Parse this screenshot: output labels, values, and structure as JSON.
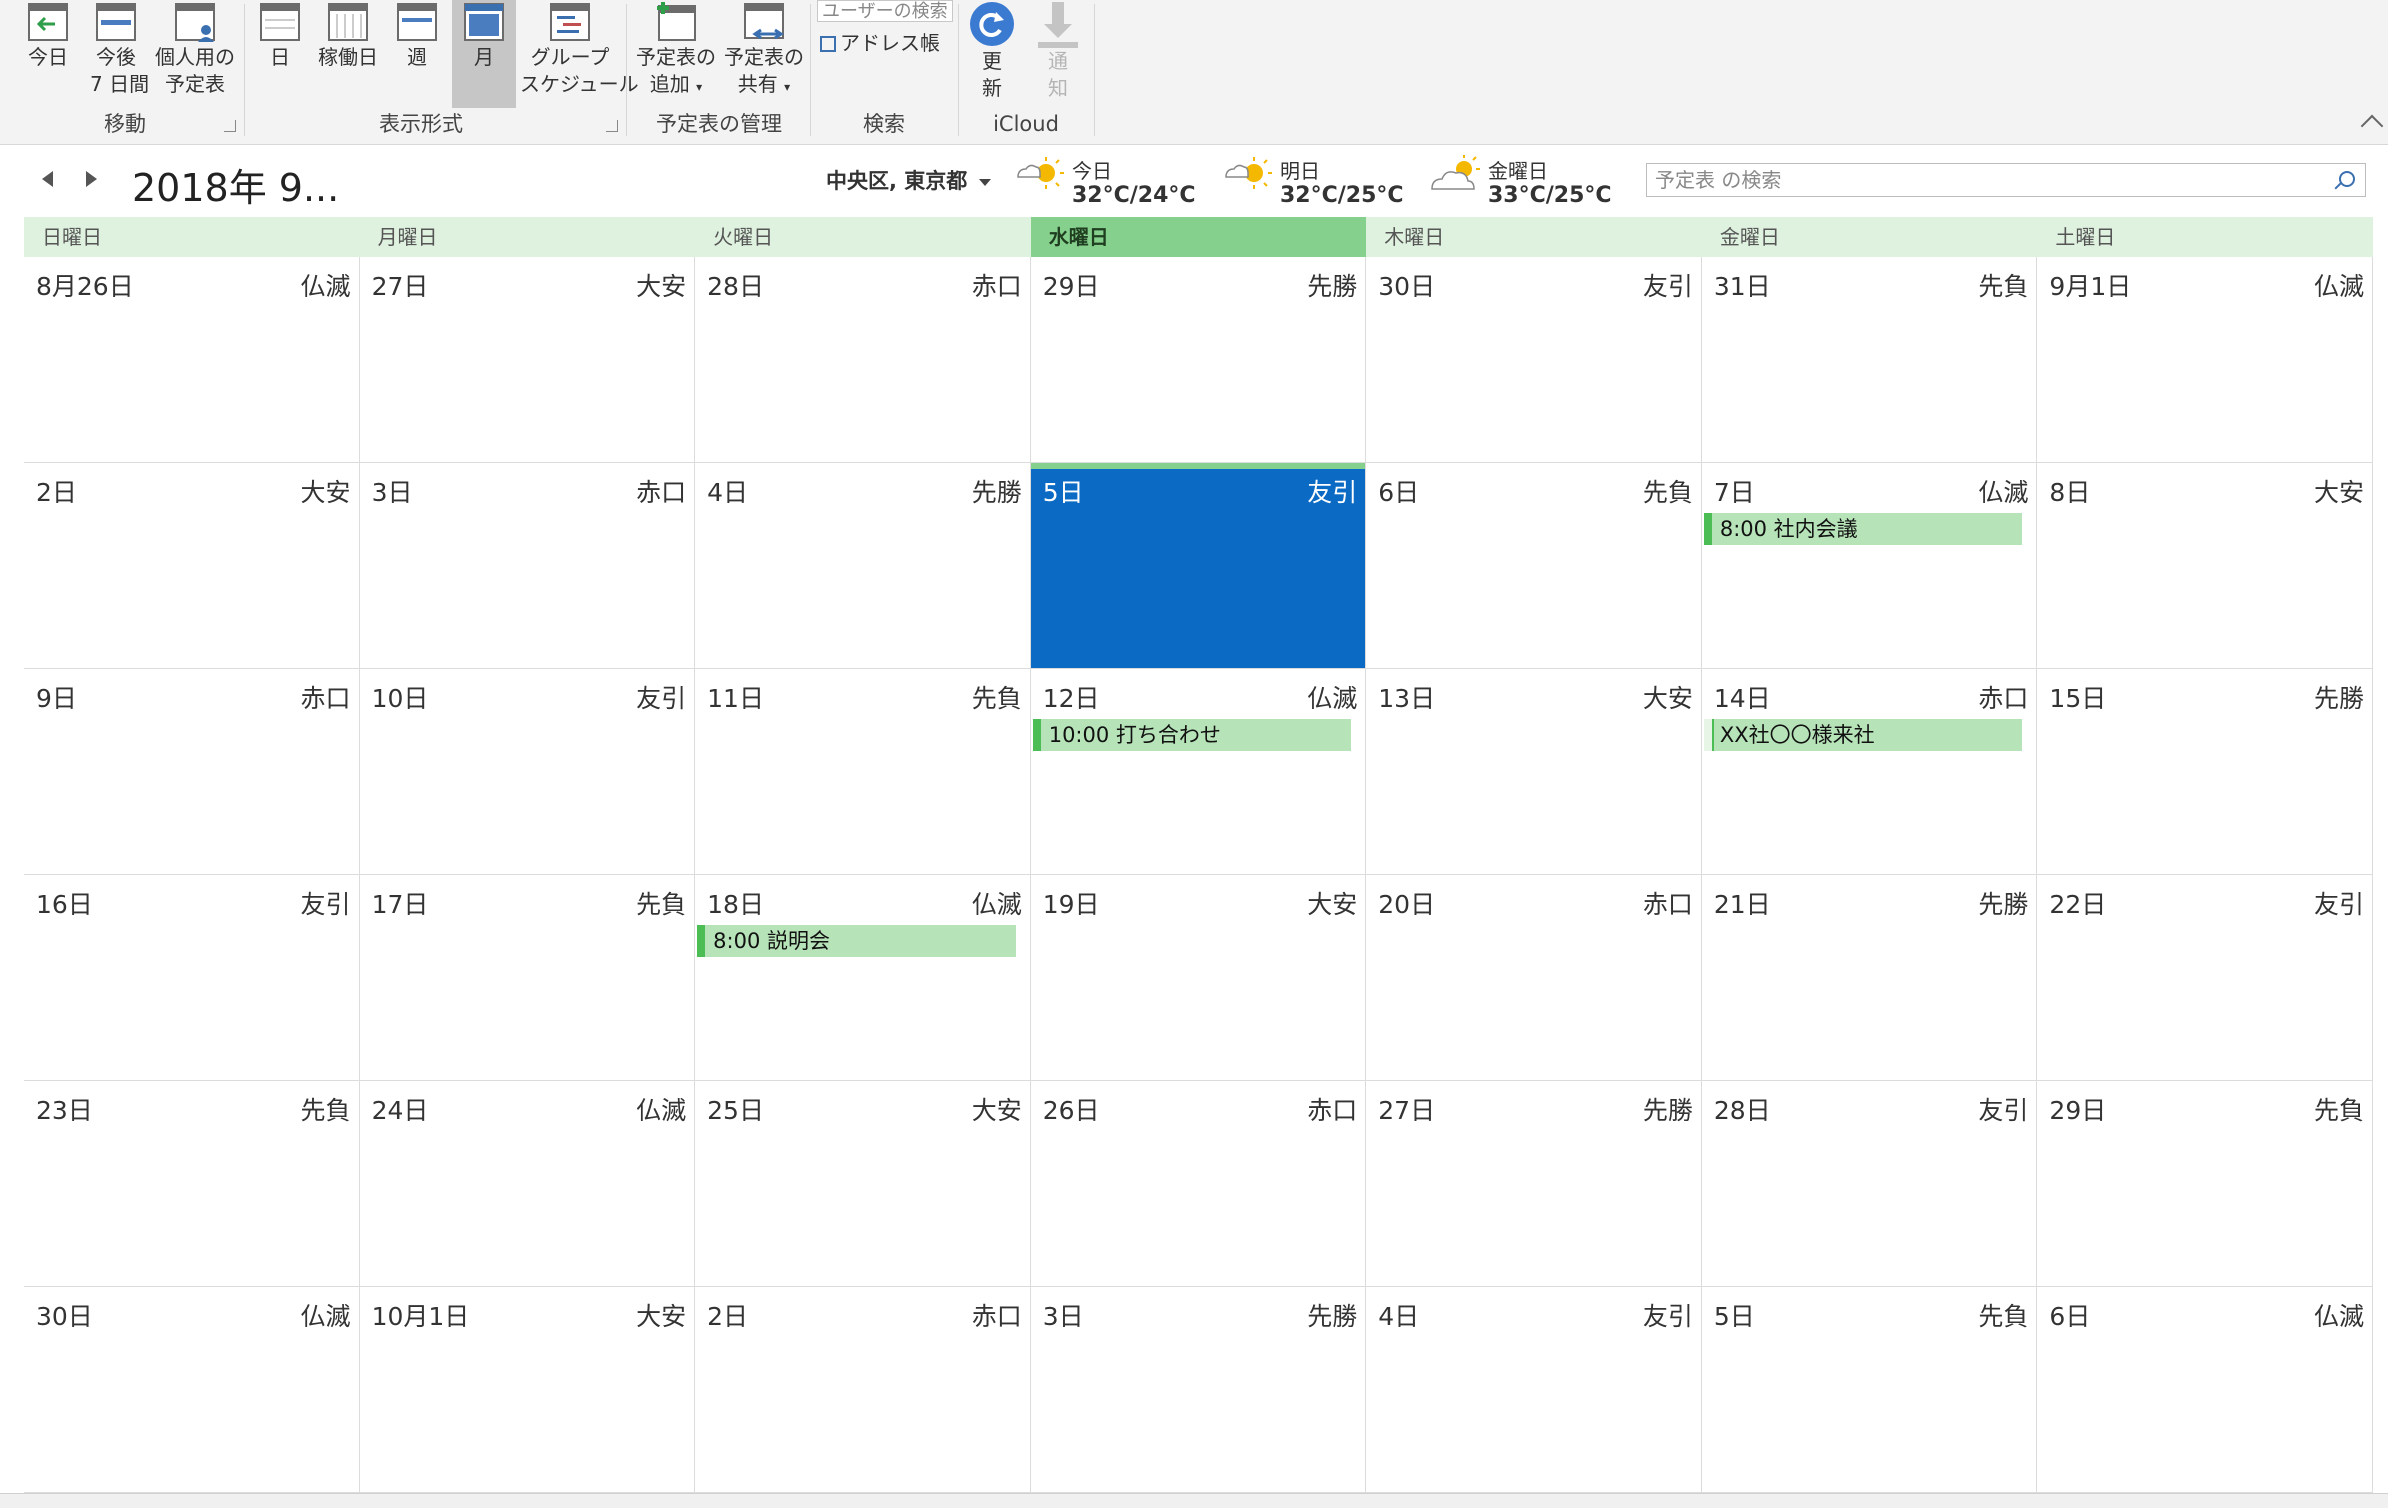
{
  "ribbon": {
    "groups": {
      "move": "移動",
      "view": "表示形式",
      "manage": "予定表の管理",
      "search": "検索",
      "icloud": "iCloud"
    },
    "buttons": {
      "today": "今日",
      "next7_line1": "今後",
      "next7_line2": "7 日間",
      "personal_line1": "個人用の",
      "personal_line2": "予定表",
      "day": "日",
      "workweek": "稼働日",
      "week": "週",
      "month": "月",
      "group_line1": "グループ",
      "group_line2": "スケジュール",
      "add_line1": "予定表の",
      "add_line2": "追加",
      "share_line1": "予定表の",
      "share_line2": "共有",
      "refresh_line1": "更",
      "refresh_line2": "新",
      "notify_line1": "通",
      "notify_line2": "知"
    },
    "user_search_placeholder": "ユーザーの検索",
    "address_book": "アドレス帳"
  },
  "header": {
    "month_title": "2018年 9...",
    "location": "中央区, 東京都",
    "weather": [
      {
        "day": "今日",
        "temp": "32°C/24°C",
        "icon": "sun-cloud-icon"
      },
      {
        "day": "明日",
        "temp": "32°C/25°C",
        "icon": "sun-cloud-icon"
      },
      {
        "day": "金曜日",
        "temp": "33°C/25°C",
        "icon": "cloud-sun-icon"
      }
    ],
    "search_placeholder": "予定表 の検索"
  },
  "calendar": {
    "weekdays": [
      "日曜日",
      "月曜日",
      "火曜日",
      "水曜日",
      "木曜日",
      "金曜日",
      "土曜日"
    ],
    "today_column": 3,
    "weeks": [
      [
        {
          "day": "8月26日",
          "rokuyo": "仏滅"
        },
        {
          "day": "27日",
          "rokuyo": "大安"
        },
        {
          "day": "28日",
          "rokuyo": "赤口"
        },
        {
          "day": "29日",
          "rokuyo": "先勝"
        },
        {
          "day": "30日",
          "rokuyo": "友引"
        },
        {
          "day": "31日",
          "rokuyo": "先負"
        },
        {
          "day": "9月1日",
          "rokuyo": "仏滅"
        }
      ],
      [
        {
          "day": "2日",
          "rokuyo": "大安"
        },
        {
          "day": "3日",
          "rokuyo": "赤口"
        },
        {
          "day": "4日",
          "rokuyo": "先勝"
        },
        {
          "day": "5日",
          "rokuyo": "友引",
          "today": true
        },
        {
          "day": "6日",
          "rokuyo": "先負"
        },
        {
          "day": "7日",
          "rokuyo": "仏滅",
          "event": "8:00 社内会議"
        },
        {
          "day": "8日",
          "rokuyo": "大安"
        }
      ],
      [
        {
          "day": "9日",
          "rokuyo": "赤口"
        },
        {
          "day": "10日",
          "rokuyo": "友引"
        },
        {
          "day": "11日",
          "rokuyo": "先負"
        },
        {
          "day": "12日",
          "rokuyo": "仏滅",
          "event": "10:00 打ち合わせ"
        },
        {
          "day": "13日",
          "rokuyo": "大安"
        },
        {
          "day": "14日",
          "rokuyo": "赤口",
          "event": "XX社〇〇様来社",
          "tentative": true
        },
        {
          "day": "15日",
          "rokuyo": "先勝"
        }
      ],
      [
        {
          "day": "16日",
          "rokuyo": "友引"
        },
        {
          "day": "17日",
          "rokuyo": "先負"
        },
        {
          "day": "18日",
          "rokuyo": "仏滅",
          "event": "8:00 説明会"
        },
        {
          "day": "19日",
          "rokuyo": "大安"
        },
        {
          "day": "20日",
          "rokuyo": "赤口"
        },
        {
          "day": "21日",
          "rokuyo": "先勝"
        },
        {
          "day": "22日",
          "rokuyo": "友引"
        }
      ],
      [
        {
          "day": "23日",
          "rokuyo": "先負"
        },
        {
          "day": "24日",
          "rokuyo": "仏滅"
        },
        {
          "day": "25日",
          "rokuyo": "大安"
        },
        {
          "day": "26日",
          "rokuyo": "赤口"
        },
        {
          "day": "27日",
          "rokuyo": "先勝"
        },
        {
          "day": "28日",
          "rokuyo": "友引"
        },
        {
          "day": "29日",
          "rokuyo": "先負"
        }
      ],
      [
        {
          "day": "30日",
          "rokuyo": "仏滅"
        },
        {
          "day": "10月1日",
          "rokuyo": "大安"
        },
        {
          "day": "2日",
          "rokuyo": "赤口"
        },
        {
          "day": "3日",
          "rokuyo": "先勝"
        },
        {
          "day": "4日",
          "rokuyo": "友引"
        },
        {
          "day": "5日",
          "rokuyo": "先負"
        },
        {
          "day": "6日",
          "rokuyo": "仏滅"
        }
      ]
    ]
  },
  "colors": {
    "today_fill": "#0a6ac4",
    "weekday_header": "#dff1df",
    "today_header": "#86d08e",
    "event_fill": "#b6e3b8",
    "event_bar": "#4cbc55"
  }
}
